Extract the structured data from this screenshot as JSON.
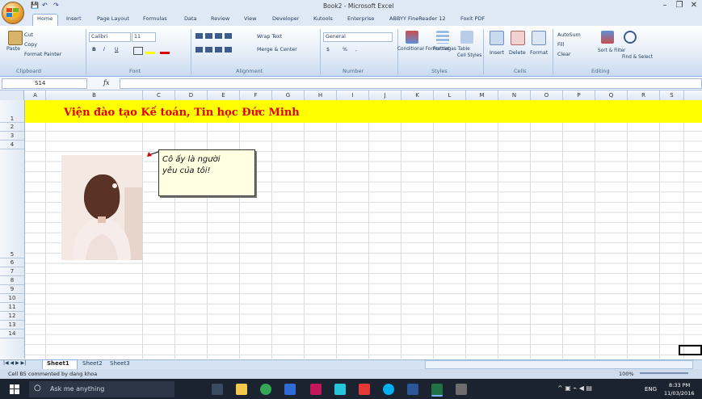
{
  "window": {
    "title": "Book2 - Microsoft Excel",
    "minimize": "–",
    "restore": "❐",
    "close": "✕"
  },
  "qat": {
    "save": "💾",
    "undo": "↶",
    "redo": "↷"
  },
  "tabs": [
    "Home",
    "Insert",
    "Page Layout",
    "Formulas",
    "Data",
    "Review",
    "View",
    "Developer",
    "Kutools",
    "Enterprise",
    "ABBYY FineReader 12",
    "Foxit PDF"
  ],
  "ribbon": {
    "clipboard": {
      "paste": "Paste",
      "cut": "Cut",
      "copy": "Copy",
      "format_painter": "Format Painter",
      "label": "Clipboard"
    },
    "font": {
      "name": "Calibri",
      "size": "11",
      "label": "Font",
      "bold": "B",
      "italic": "I",
      "underline": "U"
    },
    "alignment": {
      "wrap": "Wrap Text",
      "merge": "Merge & Center",
      "label": "Alignment"
    },
    "number": {
      "format": "General",
      "dollar": "$",
      "percent": "%",
      "comma": ",",
      "label": "Number"
    },
    "styles": {
      "conditional": "Conditional Formatting",
      "format_table": "Format as Table",
      "cell_styles": "Cell Styles",
      "label": "Styles"
    },
    "cells": {
      "insert": "Insert",
      "delete": "Delete",
      "format": "Format",
      "label": "Cells"
    },
    "editing": {
      "autosum": "AutoSum",
      "fill": "Fill",
      "clear": "Clear",
      "sort": "Sort & Filter",
      "find": "Find & Select",
      "label": "Editing"
    }
  },
  "formula_bar": {
    "name_box": "S14",
    "fx": "fx",
    "value": ""
  },
  "columns": [
    "A",
    "B",
    "C",
    "D",
    "E",
    "F",
    "G",
    "H",
    "I",
    "J",
    "K",
    "L",
    "M",
    "N",
    "O",
    "P",
    "Q",
    "R",
    "S"
  ],
  "rows": [
    "1",
    "2",
    "3",
    "4",
    "5",
    "6",
    "7",
    "8",
    "9",
    "10",
    "11",
    "12",
    "13",
    "14"
  ],
  "cell_title": "Viện đào tạo Kế toán, Tin học Đức Minh",
  "comment": {
    "line1": "Cô ấy là người",
    "line2": "yêu của tôi!"
  },
  "sheets": [
    "Sheet1",
    "Sheet2",
    "Sheet3"
  ],
  "status": {
    "message": "Cell B5 commented by dang khoa",
    "zoom": "100%"
  },
  "taskbar": {
    "search": "Ask me anything",
    "lang": "ENG",
    "time": "8:33 PM",
    "date": "11/03/2016"
  },
  "colors": {
    "accent": "#1e395b",
    "title_red": "#e00000",
    "row_fill": "#ffff00",
    "comment_bg": "#ffffe1"
  }
}
